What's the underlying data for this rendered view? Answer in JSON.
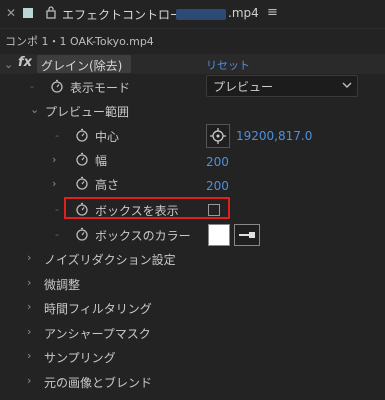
{
  "tab": {
    "title": "エフェクトコントロール",
    "filename_ext": ".mp4"
  },
  "composition": {
    "label": "コンポ 1・1 OAK-Tokyo.mp4"
  },
  "effect": {
    "name": "グレイン(除去)",
    "reset_label": "リセット"
  },
  "properties": {
    "display_mode": {
      "label": "表示モード",
      "value": "プレビュー"
    },
    "preview_range": {
      "label": "プレビュー範囲",
      "center": {
        "label": "中心",
        "value": "19200,817.0"
      },
      "width": {
        "label": "幅",
        "value": "200"
      },
      "height": {
        "label": "高さ",
        "value": "200"
      },
      "show_box": {
        "label": "ボックスを表示",
        "checked": false
      },
      "box_color": {
        "label": "ボックスのカラー",
        "color": "#ffffff"
      }
    }
  },
  "groups": [
    "ノイズリダクション設定",
    "微調整",
    "時間フィルタリング",
    "アンシャープマスク",
    "サンプリング",
    "元の画像とブレンド"
  ],
  "colors": {
    "accent_blue": "#4d8fe0",
    "highlight_red": "#e0201c",
    "background": "#232323"
  }
}
